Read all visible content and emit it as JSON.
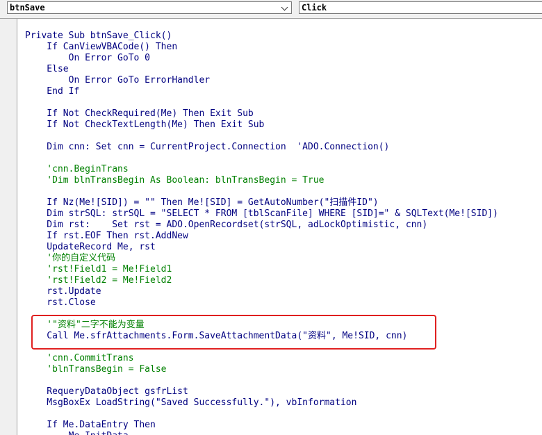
{
  "toolbar": {
    "object_combo": "btnSave",
    "procedure_combo": "Click"
  },
  "code_lines": [
    "Private Sub btnSave_Click()",
    "    If CanViewVBACode() Then",
    "        On Error GoTo 0",
    "    Else",
    "        On Error GoTo ErrorHandler",
    "    End If",
    "",
    "    If Not CheckRequired(Me) Then Exit Sub",
    "    If Not CheckTextLength(Me) Then Exit Sub",
    "",
    "    Dim cnn: Set cnn = CurrentProject.Connection  'ADO.Connection()",
    "",
    "    'cnn.BeginTrans",
    "    'Dim blnTransBegin As Boolean: blnTransBegin = True",
    "",
    "    If Nz(Me![SID]) = \"\" Then Me![SID] = GetAutoNumber(\"扫描件ID\")",
    "    Dim strSQL: strSQL = \"SELECT * FROM [tblScanFile] WHERE [SID]=\" & SQLText(Me![SID])",
    "    Dim rst:    Set rst = ADO.OpenRecordset(strSQL, adLockOptimistic, cnn)",
    "    If rst.EOF Then rst.AddNew",
    "    UpdateRecord Me, rst",
    "    '你的自定义代码",
    "    'rst!Field1 = Me!Field1",
    "    'rst!Field2 = Me!Field2",
    "    rst.Update",
    "    rst.Close",
    "",
    "    '\"资料\"二字不能为变量",
    "    Call Me.sfrAttachments.Form.SaveAttachmentData(\"资料\", Me!SID, cnn)",
    "",
    "    'cnn.CommitTrans",
    "    'blnTransBegin = False",
    "",
    "    RequeryDataObject gsfrList",
    "    MsgBoxEx LoadString(\"Saved Successfully.\"), vbInformation",
    "",
    "    If Me.DataEntry Then",
    "        Me.InitData"
  ],
  "comment_lines": [
    12,
    13,
    20,
    21,
    22,
    26,
    29,
    30
  ],
  "colors": {
    "code_text": "#000080",
    "comment": "#008000",
    "highlight_border": "#e02020"
  }
}
